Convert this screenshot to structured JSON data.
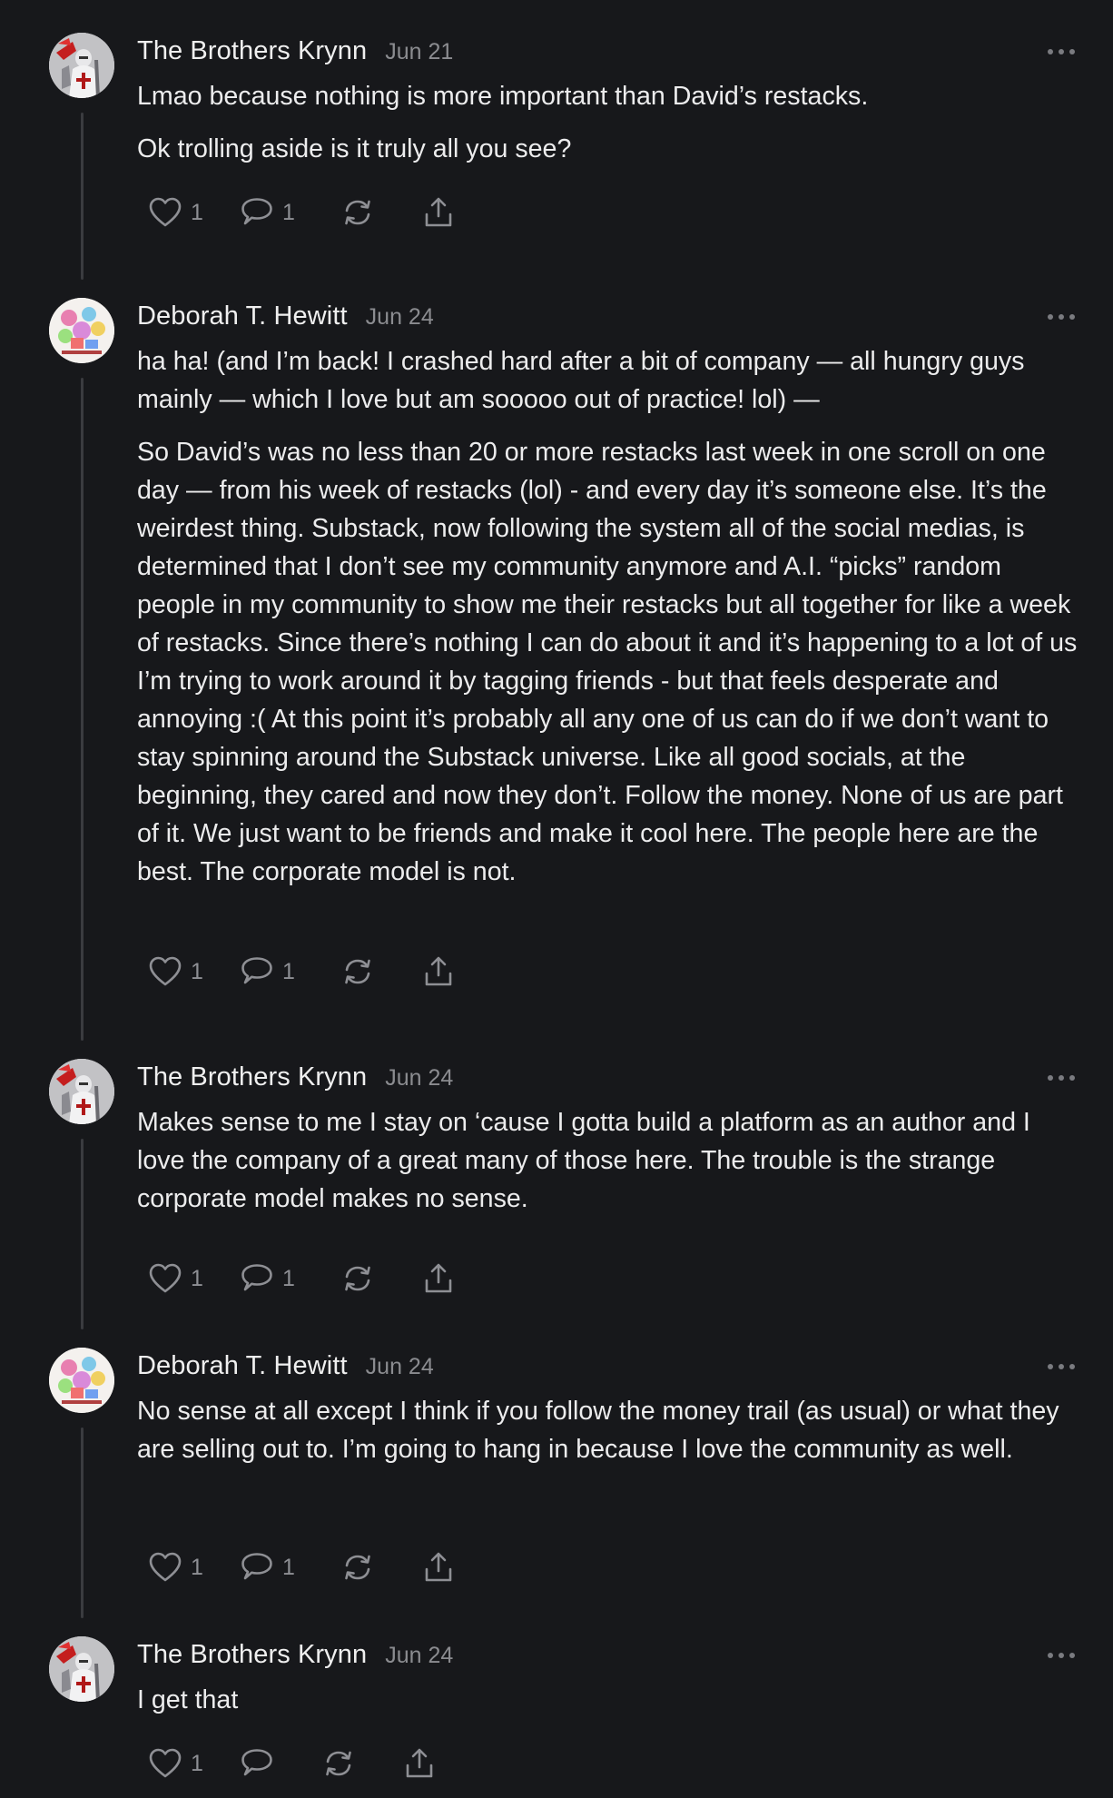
{
  "comments": [
    {
      "author": "The Brothers Krynn",
      "date": "Jun 21",
      "paragraphs": [
        "Lmao because nothing is more important than David’s restacks.",
        "Ok trolling aside is it truly all you see?"
      ],
      "likes": "1",
      "replies": "1"
    },
    {
      "author": "Deborah T. Hewitt",
      "date": "Jun 24",
      "paragraphs": [
        "ha ha! (and I’m back! I crashed hard after a bit of company — all hungry guys mainly — which I love but am sooooo out of practice! lol) —",
        "So David’s was no less than 20 or more restacks last week in one scroll on one day — from his week of restacks (lol) - and every day it’s someone else. It’s the weirdest thing. Substack, now following the system all of the social medias, is determined that I don’t see my community anymore and A.I. “picks” random people in my community to show me their restacks but all together for like a week of restacks. Since there’s nothing I can do about it and it’s happening to a lot of us I’m trying to work around it by tagging friends - but that feels desperate and annoying :( At this point it’s probably all any one of us can do if we don’t want to stay spinning around the Substack universe. Like all good socials, at the beginning, they cared and now they don’t. Follow the money. None of us are part of it. We just want to be friends and make it cool here. The people here are the best. The corporate model is not."
      ],
      "likes": "1",
      "replies": "1"
    },
    {
      "author": "The Brothers Krynn",
      "date": "Jun 24",
      "paragraphs": [
        "Makes sense to me I stay on ‘cause I gotta build a platform as an author and I love the company of a great many of those here. The trouble is the strange corporate model makes no sense."
      ],
      "likes": "1",
      "replies": "1"
    },
    {
      "author": "Deborah T. Hewitt",
      "date": "Jun 24",
      "paragraphs": [
        "No sense at all except I think if you follow the money trail (as usual) or what they are selling out to. I’m going to hang in because I love the community as well."
      ],
      "likes": "1",
      "replies": "1"
    },
    {
      "author": "The Brothers Krynn",
      "date": "Jun 24",
      "paragraphs": [
        "I get that"
      ],
      "likes": "1",
      "replies": ""
    }
  ],
  "icons": {
    "like": "heart-icon",
    "reply": "speech-bubble-icon",
    "restack": "restack-icon",
    "share": "share-icon",
    "more": "more-dots-icon"
  },
  "colors": {
    "background": "#17181b",
    "text": "#ececed",
    "muted": "#8b8c90",
    "thread_line": "#3a3b3f"
  }
}
